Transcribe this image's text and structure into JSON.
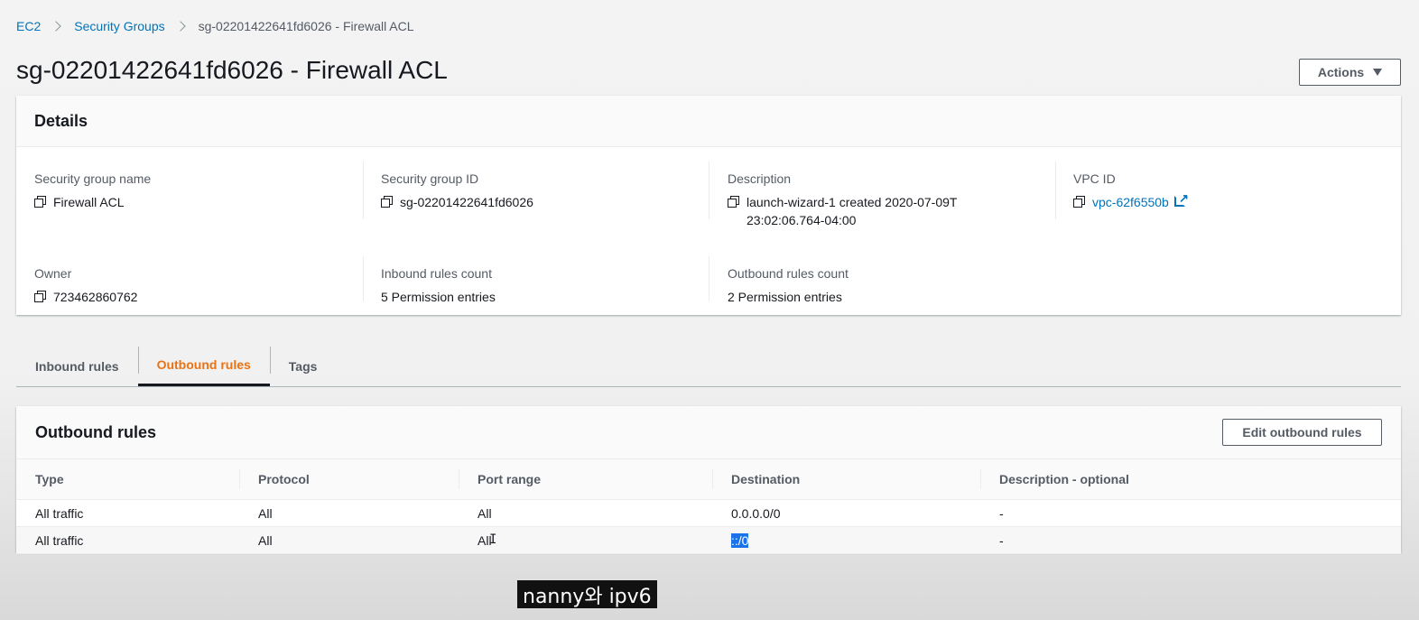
{
  "breadcrumb": {
    "items": [
      "EC2",
      "Security Groups"
    ],
    "current": "sg-02201422641fd6026 - Firewall ACL"
  },
  "page": {
    "title": "sg-02201422641fd6026 - Firewall ACL",
    "actions_label": "Actions"
  },
  "details": {
    "header": "Details",
    "fields": {
      "sg_name": {
        "label": "Security group name",
        "value": "Firewall ACL"
      },
      "sg_id": {
        "label": "Security group ID",
        "value": "sg-02201422641fd6026"
      },
      "description": {
        "label": "Description",
        "value": "launch-wizard-1 created 2020-07-09T23:02:06.764-04:00"
      },
      "vpc_id": {
        "label": "VPC ID",
        "value": "vpc-62f6550b"
      },
      "owner": {
        "label": "Owner",
        "value": "723462860762"
      },
      "inbound_count": {
        "label": "Inbound rules count",
        "value": "5 Permission entries"
      },
      "outbound_count": {
        "label": "Outbound rules count",
        "value": "2 Permission entries"
      }
    }
  },
  "tabs": [
    "Inbound rules",
    "Outbound rules",
    "Tags"
  ],
  "active_tab": "Outbound rules",
  "outbound": {
    "header": "Outbound rules",
    "edit_label": "Edit outbound rules",
    "columns": [
      "Type",
      "Protocol",
      "Port range",
      "Destination",
      "Description - optional"
    ],
    "rows": [
      [
        "All traffic",
        "All",
        "All",
        "0.0.0.0/0",
        "-"
      ],
      [
        "All traffic",
        "All",
        "All",
        "::/0",
        "-"
      ]
    ]
  },
  "caption": "nanny와 ipv6",
  "colors": {
    "link": "#0073bb",
    "active_tab": "#ec7211",
    "selection": "#1a73e8"
  }
}
